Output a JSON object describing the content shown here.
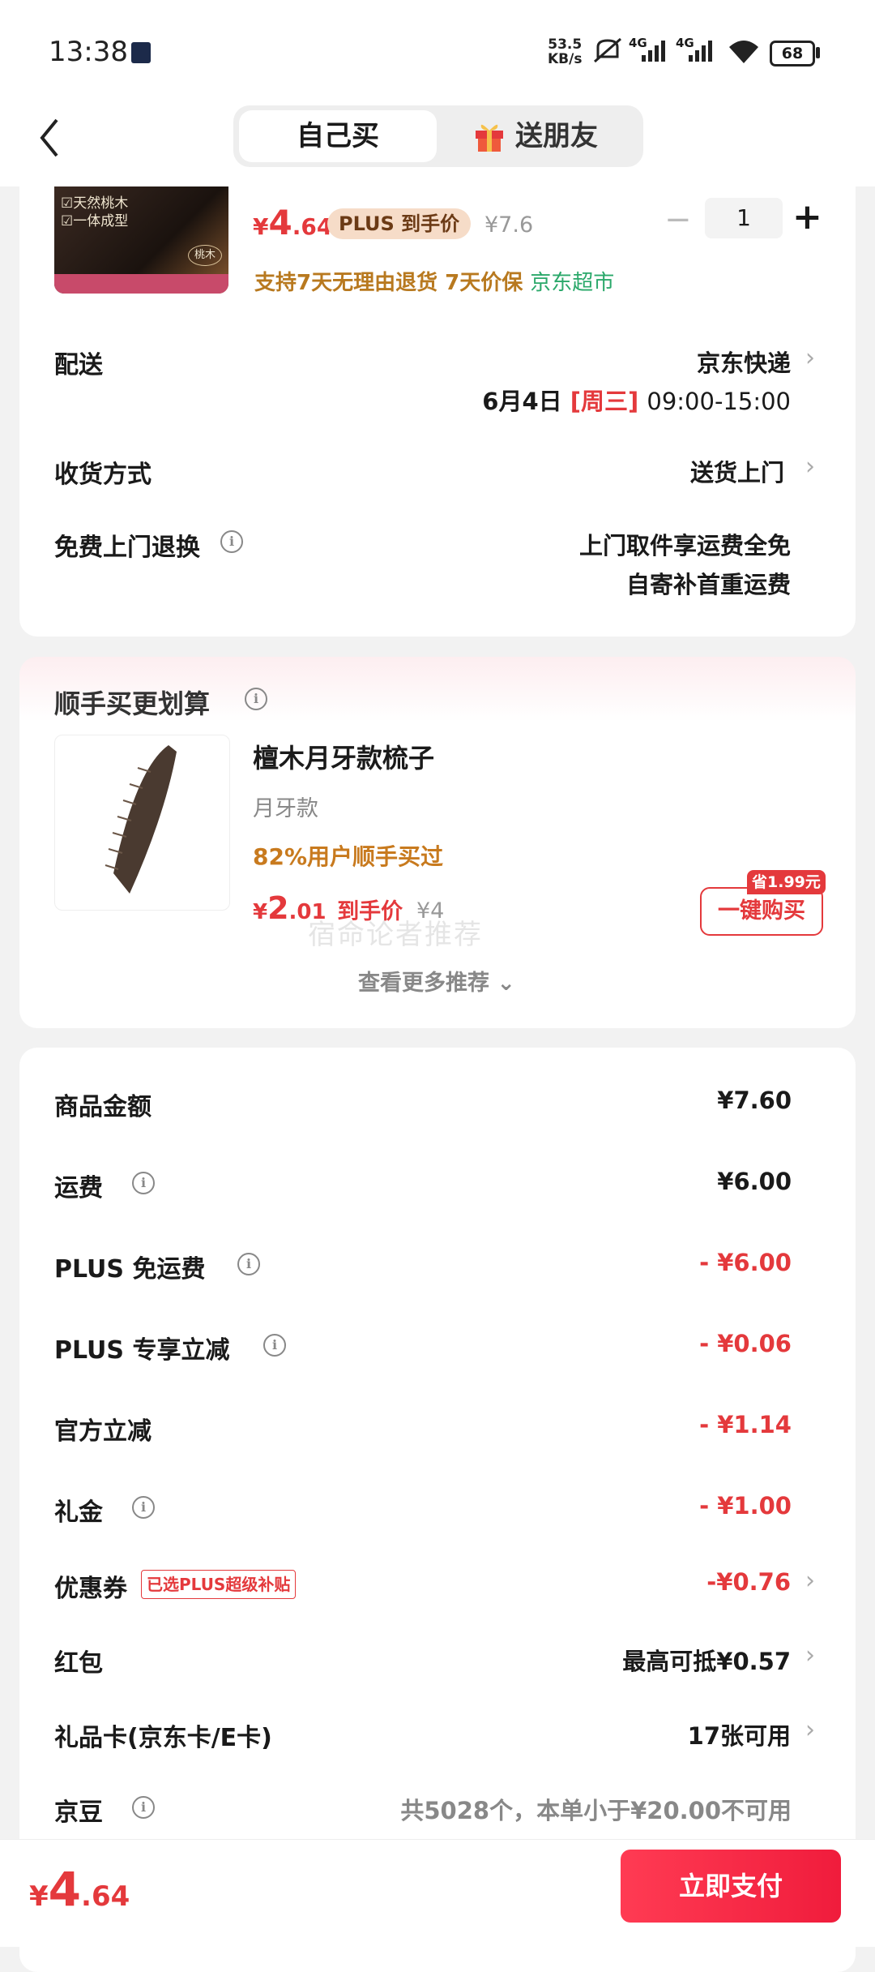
{
  "status": {
    "time": "13:38",
    "net_speed_top": "53.5",
    "net_speed_bottom": "KB/s",
    "signal1": "4G",
    "signal2": "4G",
    "battery": "68"
  },
  "header": {
    "tab_self": "自己买",
    "tab_friend": "送朋友"
  },
  "product": {
    "price_symbol": "¥",
    "price_int": "4",
    "price_dec": ".64",
    "plus_badge": "PLUS 到手价",
    "orig_price": "¥7.6",
    "qty": "1",
    "service_tags": "支持7天无理由退货  7天价保",
    "supermarket": "京东超市",
    "thumb_tag": "桃木",
    "thumb_lines": [
      "☑天然桃木",
      "☑一体成型"
    ]
  },
  "delivery": {
    "label": "配送",
    "carrier": "京东快递",
    "date": "6月4日",
    "weekday": "[周三]",
    "time": "09:00-15:00"
  },
  "receive": {
    "label": "收货方式",
    "value": "送货上门"
  },
  "return": {
    "label": "免费上门退换",
    "line1": "上门取件享运费全免",
    "line2": "自寄补首重运费"
  },
  "recommend": {
    "title": "顺手买更划算",
    "name": "檀木月牙款梳子",
    "variant": "月牙款",
    "stat": "82%用户顺手买过",
    "price_int": "2",
    "price_dec": ".01",
    "price_label": "到手价",
    "orig": "¥4",
    "save_badge": "省1.99元",
    "buy_button": "一键购买",
    "more": "查看更多推荐",
    "watermark": "宿命论者推荐"
  },
  "summary": [
    {
      "label": "商品金额",
      "value": "¥7.60",
      "info": false,
      "red": false,
      "chev": false
    },
    {
      "label": "运费",
      "value": "¥6.00",
      "info": true,
      "red": false,
      "chev": false
    },
    {
      "label": "PLUS 免运费",
      "value": "- ¥6.00",
      "info": true,
      "red": true,
      "chev": false
    },
    {
      "label": "PLUS 专享立减",
      "value": "- ¥0.06",
      "info": true,
      "red": true,
      "chev": false
    },
    {
      "label": "官方立减",
      "value": "- ¥1.14",
      "info": false,
      "red": true,
      "chev": false
    },
    {
      "label": "礼金",
      "value": "- ¥1.00",
      "info": true,
      "red": true,
      "chev": false
    },
    {
      "label": "优惠券",
      "value": "-¥0.76",
      "info": false,
      "red": true,
      "chev": true,
      "tag": "已选PLUS超级补贴"
    },
    {
      "label": "红包",
      "value": "最高可抵¥0.57",
      "info": false,
      "red": false,
      "chev": true
    },
    {
      "label": "礼品卡(京东卡/E卡)",
      "value": "17张可用",
      "info": false,
      "red": false,
      "chev": true
    },
    {
      "label": "京豆",
      "value": "共5028个，本单小于¥20.00不可用",
      "info": true,
      "red": false,
      "chev": false,
      "muted": true
    }
  ],
  "footer": {
    "price_symbol": "¥",
    "price_int": "4",
    "price_dec": ".64",
    "pay_button": "立即支付"
  },
  "colors": {
    "accent": "#e4393c",
    "plus_badge_bg": "#f6dcc8",
    "service": "#b8791f",
    "supermarket": "#2aa86a"
  }
}
